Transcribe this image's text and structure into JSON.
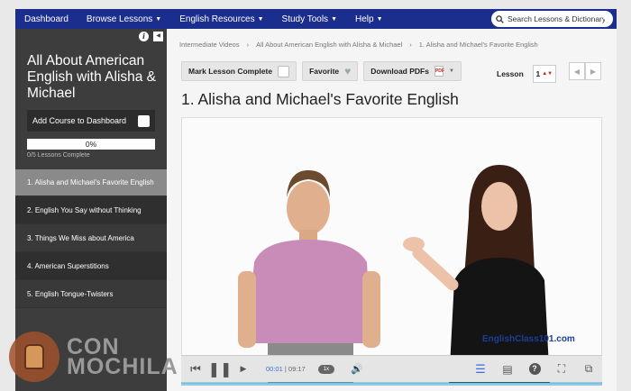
{
  "nav": {
    "items": [
      "Dashboard",
      "Browse Lessons",
      "English Resources",
      "Study Tools",
      "Help"
    ],
    "has_caret": [
      false,
      true,
      true,
      true,
      true
    ],
    "search_placeholder": "Search Lessons & Dictionary"
  },
  "sidebar": {
    "course_title": "All About American English with Alisha & Michael",
    "add_course_label": "Add Course to Dashboard",
    "progress_percent": "0%",
    "progress_sub": "0/5 Lessons Complete",
    "lessons": [
      "1. Alisha and Michael's Favorite English",
      "2. English You Say without Thinking",
      "3. Things We Miss about America",
      "4. American Superstitions",
      "5. English Tongue-Twisters"
    ]
  },
  "breadcrumb": [
    "Intermediate Videos",
    "›",
    "All About American English with Alisha & Michael",
    "›",
    "1. Alisha and Michael's Favorite English"
  ],
  "toolbar": {
    "mark_complete": "Mark Lesson Complete",
    "favorite": "Favorite",
    "download": "Download PDFs",
    "lesson_label": "Lesson",
    "lesson_value": "1"
  },
  "lesson_title": "1. Alisha and Michael's Favorite English",
  "video": {
    "watermark": "EnglishClass101.com",
    "current_time": "00:01",
    "total_time": "09:17",
    "speed": "1x"
  },
  "brand": {
    "line1": "CON",
    "line2": "MOCHILA"
  }
}
